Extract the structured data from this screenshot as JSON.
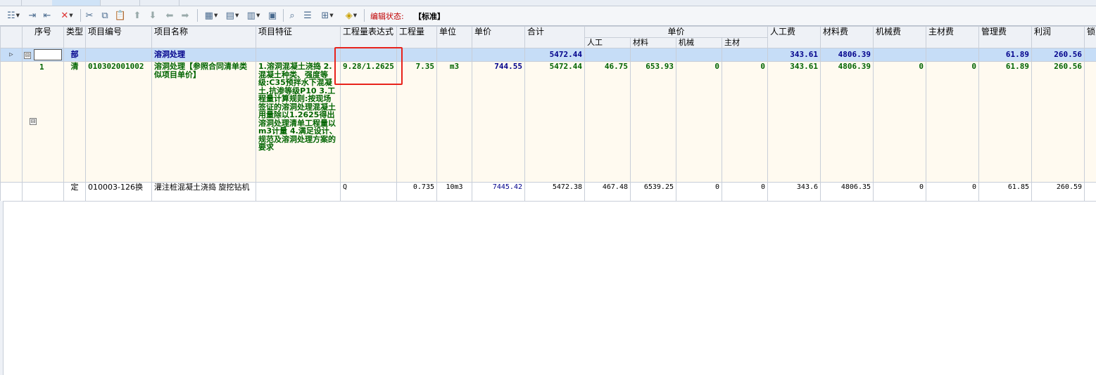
{
  "toolbar": {
    "items": [
      "insert-icon",
      "indent-icon",
      "outdent-icon",
      "delete-icon",
      "cut-icon",
      "copy-icon",
      "paste-icon",
      "move-up-icon",
      "move-down-icon",
      "move-left-icon",
      "move-right-icon",
      "quota-icon",
      "clear-icon",
      "fix-icon",
      "image-icon",
      "find-icon",
      "layout-icon",
      "tree-icon",
      "fill-color-icon"
    ],
    "status_label": "编辑状态:",
    "status_value": "【标准】"
  },
  "headers": {
    "seq": "序号",
    "type": "类型",
    "code": "项目编号",
    "name": "项目名称",
    "feature": "项目特征",
    "expr": "工程量表达式",
    "qty": "工程量",
    "unit": "单位",
    "price": "单价",
    "total": "合计",
    "unit_price_group": "单价",
    "labor": "人工",
    "material": "材料",
    "machine": "机械",
    "main_material": "主材",
    "labor_fee": "人工费",
    "material_fee": "材料费",
    "machine_fee": "机械费",
    "main_material_fee": "主材费",
    "mgmt_fee": "管理费",
    "profit": "利润",
    "lock": "锁"
  },
  "rows": {
    "bu": {
      "fold": "⊟",
      "type": "部",
      "name": "溶洞处理",
      "total": "5472.44",
      "labor_fee": "343.61",
      "material_fee": "4806.39",
      "mgmt_fee": "61.89",
      "profit": "260.56"
    },
    "qing": {
      "fold": "⊟",
      "seq": "1",
      "type": "清",
      "code": "010302001002",
      "name": "溶洞处理【参照合同清单类似项目单价】",
      "feature": "1.溶洞混凝土浇捣 2.混凝土种类、强度等级:C35预拌水下混凝土,抗渗等级P10 3.工程量计算规则:按现场签证的溶洞处理混凝土用量除以1.2625得出溶洞处理清单工程量以m3计量 4.满足设计、规范及溶洞处理方案的要求",
      "expr": "9.28/1.2625",
      "qty": "7.35",
      "unit": "m3",
      "price": "744.55",
      "total": "5472.44",
      "labor": "46.75",
      "material": "653.93",
      "machine": "0",
      "main_material": "0",
      "labor_fee": "343.61",
      "material_fee": "4806.39",
      "machine_fee": "0",
      "main_material_fee": "0",
      "mgmt_fee": "61.89",
      "profit": "260.56"
    },
    "ding": {
      "type": "定",
      "code": "010003-126换",
      "name": "灌注桩混凝土浇捣 旋挖钻机",
      "expr": "Q",
      "qty": "0.735",
      "unit": "10m3",
      "price": "7445.42",
      "total": "5472.38",
      "labor": "467.48",
      "material": "6539.25",
      "machine": "0",
      "main_material": "0",
      "labor_fee": "343.6",
      "material_fee": "4806.35",
      "machine_fee": "0",
      "main_material_fee": "0",
      "mgmt_fee": "61.85",
      "profit": "260.59"
    }
  },
  "colors": {
    "bu_row_bg": "#c6ddf7",
    "bu_text": "#00008b",
    "qing_text": "#006400",
    "highlight_border": "#e8221b",
    "status_label": "#c00000"
  }
}
